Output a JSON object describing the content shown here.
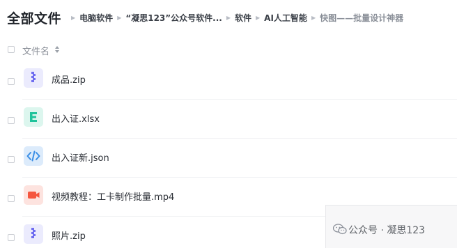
{
  "breadcrumb": {
    "root": "全部文件",
    "items": [
      "电脑软件",
      "“凝思123”公众号软件...",
      "软件",
      "AI人工智能",
      "快图——批量设计神器"
    ]
  },
  "list": {
    "header_label": "文件名",
    "files": [
      {
        "name": "成品.zip",
        "icon": "zip-icon",
        "color": "#6f6df0"
      },
      {
        "name": "出入证.xlsx",
        "icon": "excel-icon",
        "color": "#1fc39b"
      },
      {
        "name": "出入证新.json",
        "icon": "code-icon",
        "color": "#3a8ee6"
      },
      {
        "name": "视频教程：工卡制作批量.mp4",
        "icon": "video-icon",
        "color": "#f5563f"
      },
      {
        "name": "照片.zip",
        "icon": "zip-icon",
        "color": "#6f6df0"
      }
    ]
  },
  "watermark": {
    "text": "公众号 · 凝思123",
    "icon": "wechat-icon"
  }
}
